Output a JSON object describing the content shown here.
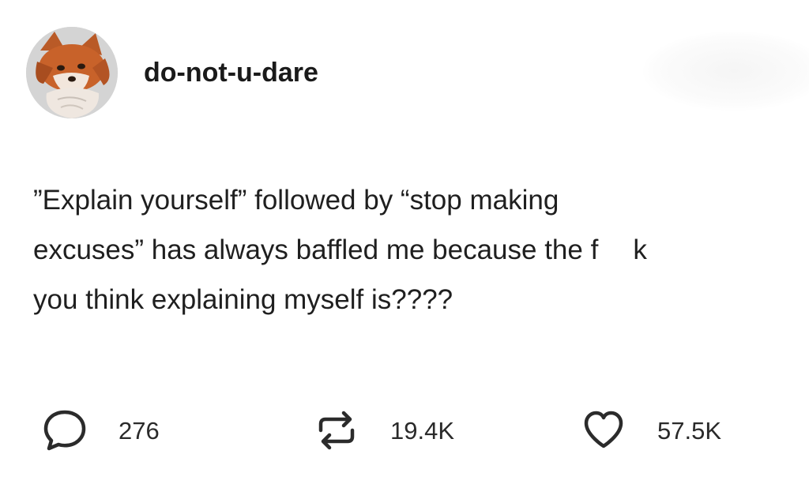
{
  "post": {
    "username": "do-not-u-dare",
    "avatar": {
      "icon": "fox-avatar-icon",
      "colors": {
        "fur": "#c8622a",
        "light": "#f2e6dc",
        "bg": "#d4d4d4"
      }
    },
    "body_lines": [
      "”Explain yourself” followed by “stop making",
      {
        "before": "excuses” has always baffled me because the f",
        "after": "k"
      },
      "you think explaining myself is????"
    ],
    "stats": {
      "replies": {
        "icon": "comment-bubble-icon",
        "count": "276"
      },
      "reblogs": {
        "icon": "reblog-arrows-icon",
        "count": "19.4K"
      },
      "likes": {
        "icon": "heart-icon",
        "count": "57.5K"
      }
    }
  }
}
